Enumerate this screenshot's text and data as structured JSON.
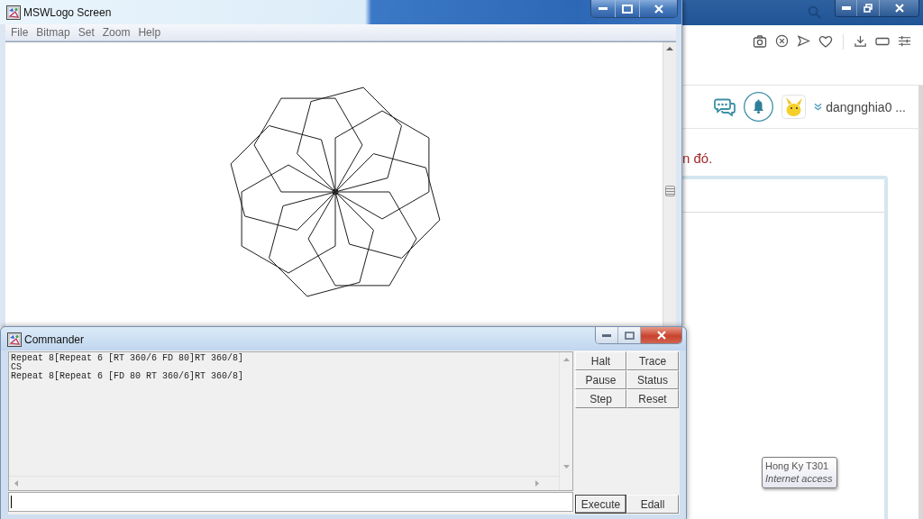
{
  "logo_window": {
    "title": "MSWLogo Screen",
    "menu": [
      "File",
      "Bitmap",
      "Set",
      "Zoom",
      "Help"
    ]
  },
  "commander": {
    "title": "Commander",
    "history": [
      "Repeat 8[Repeat 6 [RT 360/6 FD 80]RT 360/8]",
      "CS",
      "Repeat 8[Repeat 6 [FD 80 RT 360/6]RT 360/8]"
    ],
    "buttons": [
      "Halt",
      "Trace",
      "Pause",
      "Status",
      "Step",
      "Reset"
    ],
    "bottom_buttons": [
      {
        "label": "Execute",
        "default": true
      },
      {
        "label": "Edall",
        "default": false
      }
    ]
  },
  "browser": {
    "username": "dangnghia0 ...",
    "notice": "n đó."
  },
  "tooltip": {
    "title": "Hong Ky T301",
    "subtitle": "Internet access"
  }
}
